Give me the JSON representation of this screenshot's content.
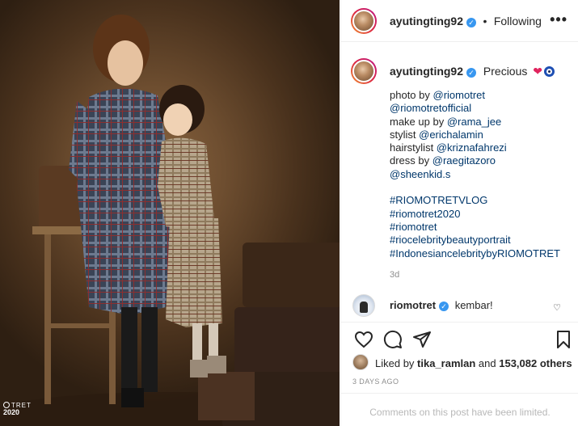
{
  "header": {
    "username": "ayutingting92",
    "separator": "•",
    "follow_status": "Following",
    "more_label": "•••"
  },
  "caption": {
    "username": "ayutingting92",
    "title": "Precious",
    "emoji_heart": "❤",
    "lines": [
      {
        "prefix": "photo by ",
        "link": "@riomotret"
      },
      {
        "prefix": "",
        "link": "@riomotretofficial"
      },
      {
        "prefix": "make up by ",
        "link": "@rama_jee"
      },
      {
        "prefix": "stylist ",
        "link": "@erichalamin"
      },
      {
        "prefix": "hairstylist ",
        "link": "@kriznafahrezi"
      },
      {
        "prefix": "dress by ",
        "link": "@raegitazoro"
      },
      {
        "prefix": "",
        "link": "@sheenkid.s"
      }
    ],
    "hashtags": [
      "#RIOMOTRETVLOG",
      "#riomotret2020",
      "#riomotret",
      "#riocelebritybeautyportrait",
      "#IndonesiancelebritybyRIOMOTRET"
    ],
    "time": "3d"
  },
  "comment": {
    "username": "riomotret",
    "text": "kembar!",
    "like_icon": "heart-outline-icon"
  },
  "likes": {
    "prefix": "Liked by ",
    "liker": "tika_ramlan",
    "middle": " and ",
    "count": "153,082 others"
  },
  "post_date": "3 DAYS AGO",
  "comments_limited": "Comments on this post have been limited.",
  "watermark": {
    "line1": "TRET",
    "line2": "2020"
  },
  "colors": {
    "link": "#00376b",
    "verified": "#3897f0",
    "muted": "#8e8e8e",
    "photo_background": "#6e4e30"
  }
}
